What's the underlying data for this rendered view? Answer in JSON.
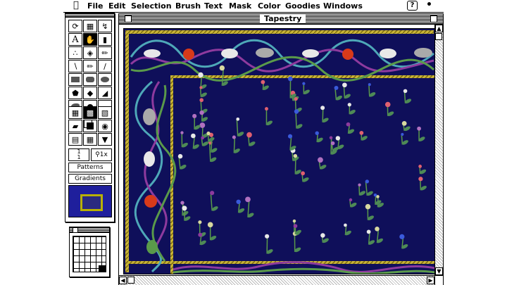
{
  "menubar": {
    "apple_icon": "apple-icon",
    "items": [
      "File",
      "Edit",
      "Selection",
      "Brush",
      "Text",
      "Mask",
      "Color",
      "Goodies",
      "Windows"
    ],
    "help_label": "?",
    "app_icon": "app-icon"
  },
  "palette": {
    "patterns_label": "Patterns",
    "gradients_label": "Gradients",
    "zoom_label": "1x",
    "ratio_top": "1",
    "ratio_bottom": "1"
  },
  "document": {
    "title": "Tapestry",
    "colors": {
      "background": "#0f0f5a",
      "border_gold": "#c9b437",
      "vine_green": "#5a9a4a",
      "purple": "#8e3a9e",
      "red_apple": "#d83a1a"
    }
  }
}
